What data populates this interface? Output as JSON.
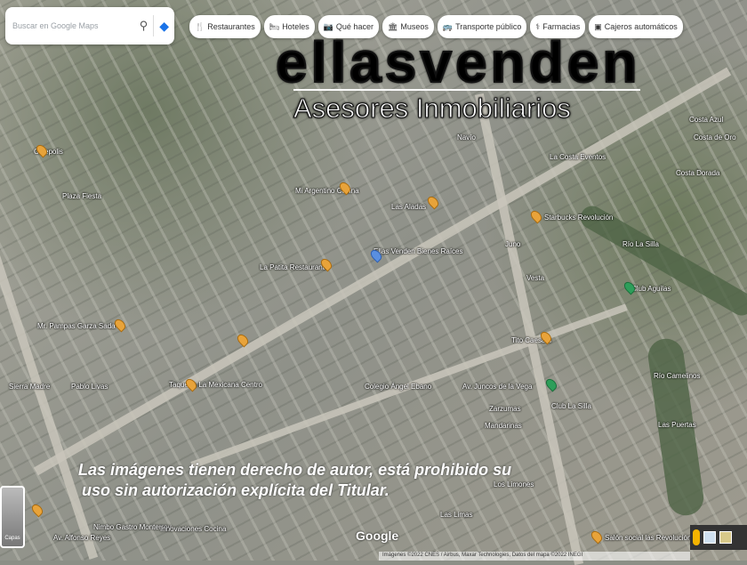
{
  "search": {
    "placeholder": "Buscar en Google Maps"
  },
  "chips": [
    {
      "icon": "fork-knife-icon",
      "glyph": "🍴",
      "label": "Restaurantes"
    },
    {
      "icon": "bed-icon",
      "glyph": "🛏",
      "label": "Hoteles"
    },
    {
      "icon": "camera-icon",
      "glyph": "📷",
      "label": "Qué hacer"
    },
    {
      "icon": "museum-icon",
      "glyph": "🏛",
      "label": "Museos"
    },
    {
      "icon": "bus-icon",
      "glyph": "🚌",
      "label": "Transporte público"
    },
    {
      "icon": "pharmacy-icon",
      "glyph": "⚕",
      "label": "Farmacias"
    },
    {
      "icon": "atm-icon",
      "glyph": "▣",
      "label": "Cajeros automáticos"
    }
  ],
  "logo": {
    "name": "ellasvenden",
    "tagline": "Asesores Inmobiliarios"
  },
  "watermark": {
    "line1": "Las imágenes tienen derecho de autor, está prohibido su",
    "line2": "uso sin autorización explícita del Titular."
  },
  "map_labels": [
    "Cinepolis",
    "Plaza Fiesta",
    "Mi Argentino Cocina",
    "Navío",
    "Las Aladas",
    "Starbucks Revolución",
    "La Costa Eventos",
    "Costa Azul",
    "Costa de Oro",
    "Costa Dorada",
    "Río La Silla",
    "Juno",
    "Vesta",
    "La Patita Restaurante",
    "Ellas Venden Bienes Raíces",
    "Mr. Pampas Garza Sada",
    "Taquería La Mexicana Centro",
    "Club Aguilas",
    "Tito Caesars",
    "Colegio Ángel Ebano",
    "Av. Juncos de la Vega",
    "Zarzumas",
    "Club La Silla",
    "Mandarinas",
    "Río Camelinos",
    "Las Puertas",
    "Los Limones",
    "Las Limas",
    "Nimbo Gastro Monterrey",
    "Innovaciones Cocina",
    "Av. Alfonso Reyes",
    "Salón social las Revolución",
    "Sierra Madre",
    "Pablo Livas"
  ],
  "controls": {
    "layers": "Capas",
    "google": "Google",
    "attribution": "Imágenes ©2022 CNES / Airbus, Maxar Technologies, Datos del mapa ©2022 INEGI"
  }
}
